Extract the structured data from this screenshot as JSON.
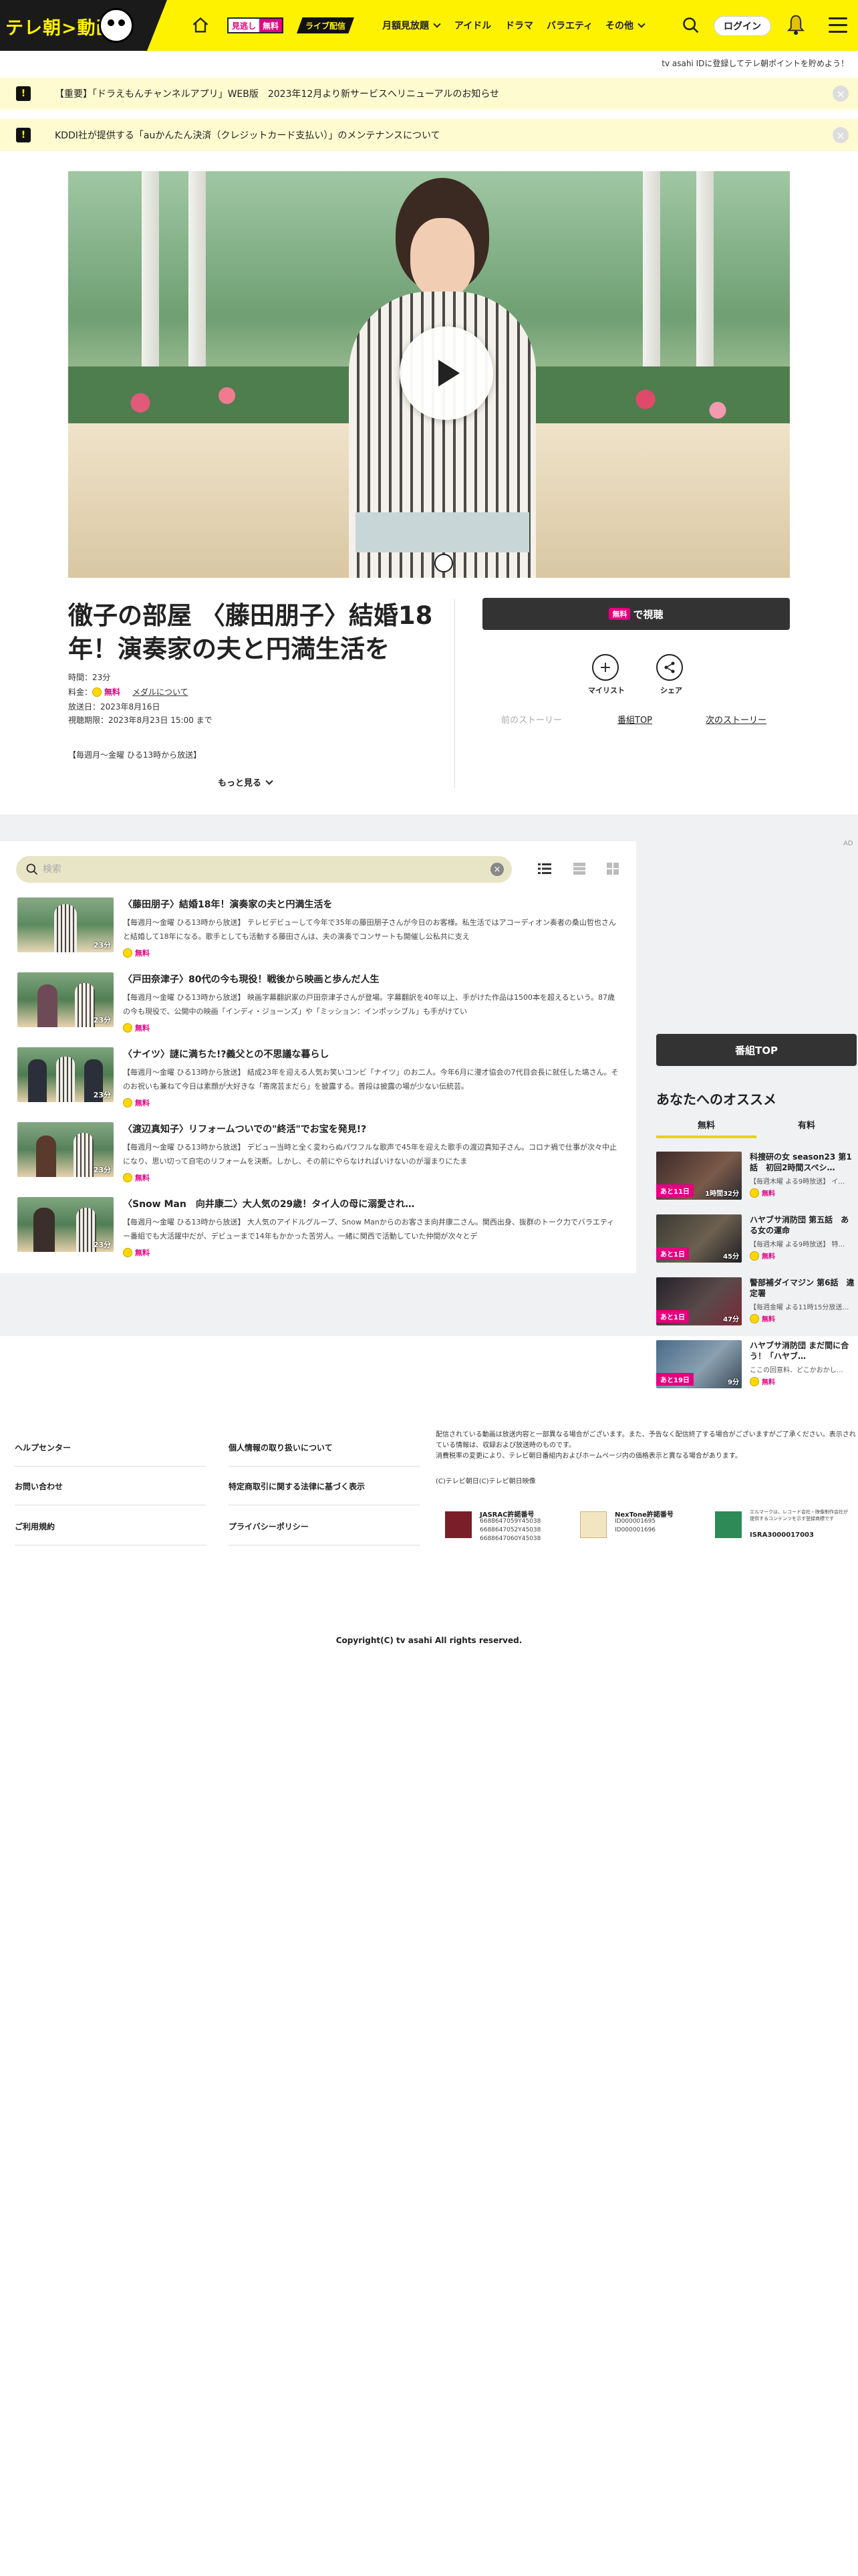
{
  "header": {
    "logo_text": "テレ朝",
    "logo_text2": "動画",
    "free_badge_a": "見逃し",
    "free_badge_b": "無料",
    "live_badge": "ライブ配信",
    "nav": [
      {
        "label": "月額見放題",
        "has_menu": true
      },
      {
        "label": "アイドル",
        "has_menu": false
      },
      {
        "label": "ドラマ",
        "has_menu": false
      },
      {
        "label": "バラエティ",
        "has_menu": false
      },
      {
        "label": "その他",
        "has_menu": true
      }
    ],
    "login_label": "ログイン"
  },
  "register_note": "tv asahi IDに登録してテレ朝ポイントを貯めよう！",
  "notices": [
    {
      "text": "【重要】「ドラえもんチャンネルアプリ」WEB版　2023年12月より新サービスへリニューアルのお知らせ"
    },
    {
      "text": "KDDI社が提供する「auかんたん決済（クレジットカード支払い）」のメンテナンスについて"
    }
  ],
  "episode": {
    "title": "徹子の部屋 〈藤田朋子〉結婚18年！演奏家の夫と円満生活を",
    "duration": "時間：23分",
    "price_label": "料金：",
    "price_value": "無料",
    "price_link": "メダルについて",
    "air_date": "放送日：2023年8月16日",
    "deadline": "視聴期限：2023年8月23日 15:00 まで",
    "broadcast": "【毎週月～金曜 ひる13時から放送】",
    "more_label": "もっと見る",
    "watch_free_badge": "無料",
    "watch_label": "で視聴",
    "mylist_label": "マイリスト",
    "share_label": "シェア",
    "prev_story": "前のストーリー",
    "program_top": "番組TOP",
    "next_story": "次のストーリー"
  },
  "list": {
    "search_placeholder": "検索",
    "items": [
      {
        "title": "〈藤田朋子〉結婚18年！演奏家の夫と円満生活を",
        "desc": "【毎週月～金曜 ひる13時から放送】 テレビデビューして今年で35年の藤田朋子さんが今日のお客様。私生活ではアコーディオン奏者の桑山哲也さんと結婚して18年になる。歌手としても活動する藤田さんは、夫の演奏でコンサートも開催し公私共に支え",
        "duration": "23分",
        "free": "無料"
      },
      {
        "title": "〈戸田奈津子〉80代の今も現役！戦後から映画と歩んだ人生",
        "desc": "【毎週月～金曜 ひる13時から放送】 映画字幕翻訳家の戸田奈津子さんが登場。字幕翻訳を40年以上、手がけた作品は1500本を超えるという。87歳の今も現役で、公開中の映画「インディ・ジョーンズ」や「ミッション：インポッシブル」も手がけてい",
        "duration": "23分",
        "free": "無料"
      },
      {
        "title": "〈ナイツ〉謎に満ちた!?義父との不思議な暮らし",
        "desc": "【毎週月～金曜 ひる13時から放送】 結成23年を迎える人気お笑いコンビ「ナイツ」のお二人。今年6月に漫才協会の7代目会長に就任した塙さん。そのお祝いも兼ねて今日は素顔が大好きな「寄席芸まだら」を披露する。普段は披露の場が少ない伝統芸。",
        "duration": "23分",
        "free": "無料"
      },
      {
        "title": "〈渡辺真知子〉リフォームついでの\"終活\"でお宝を発見!?",
        "desc": "【毎週月～金曜 ひる13時から放送】 デビュー当時と全く変わらぬパワフルな歌声で45年を迎えた歌手の渡辺真知子さん。コロナ禍で仕事が次々中止になり、思い切って自宅のリフォームを決断。しかし、その前にやらなければいけないのが溜まりにたま",
        "duration": "23分",
        "free": "無料"
      },
      {
        "title": "〈Snow Man　向井康二〉大人気の29歳！タイ人の母に溺愛され…",
        "desc": "【毎週月～金曜 ひる13時から放送】 大人気のアイドルグループ、Snow Manからのお客さま向井康二さん。関西出身、抜群のトーク力でバラエティー番組でも大活躍中だが、デビューまで14年もかかった苦労人。一緒に関西で活動していた仲間が次々とデ",
        "duration": "23分",
        "free": "無料"
      }
    ]
  },
  "sidebar": {
    "ad_label": "AD",
    "program_top": "番組TOP",
    "rec_title": "あなたへのオススメ",
    "tab_free": "無料",
    "tab_paid": "有料",
    "items": [
      {
        "left": "あと11日",
        "len": "1時間32分",
        "title": "科捜研の女 season23 第1話　初回2時間スペシ…",
        "desc": "【毎週木曜 よる9時放送】 イ…",
        "free": "無料"
      },
      {
        "left": "あと1日",
        "len": "45分",
        "title": "ハヤブサ消防団 第五話　ある女の運命",
        "desc": "【毎週木曜 よる9時放送】 特…",
        "free": "無料"
      },
      {
        "left": "あと1日",
        "len": "47分",
        "title": "警部補ダイマジン 第6話　違定署",
        "desc": "【毎週金曜 よる11時15分放送…",
        "free": "無料"
      },
      {
        "left": "あと19日",
        "len": "9分",
        "title": "ハヤブサ消防団 まだ間に合う！「ハヤブ…",
        "desc": "ここの回意料、どこかおかし…",
        "free": "無料"
      }
    ]
  },
  "footer": {
    "links": [
      "ヘルプセンター",
      "お問い合わせ",
      "ご利用規約",
      "個人情報の取り扱いについて",
      "特定商取引に関する法律に基づく表示",
      "プライバシーポリシー"
    ],
    "note_lines": [
      "配信されている動画は放送内容と一部異なる場合がございます。また、予告なく配信終了する場合がございますがご了承ください。表示されている情報は、収録および放送時のものです。",
      "消費税率の変更により、テレビ朝日番組内およびホームページ内の価格表示と異なる場合があります。"
    ],
    "copyright2": "(C)テレビ朝日(C)テレビ朝日映像",
    "licenses": [
      {
        "title": "JASRAC許諾番号",
        "nums": [
          "6688647059Y45038",
          "6688647052Y45038",
          "6688647060Y45038"
        ]
      },
      {
        "title": "NexTone許諾番号",
        "nums": [
          "ID000001695",
          "ID000001696"
        ]
      },
      {
        "title": "ISRA3000017003",
        "nums": [
          "エルマークは、レコード会社・映像制作会社が提供するコンテンツを示す登録商標です"
        ]
      }
    ],
    "copyright": "Copyright(C) tv asahi All rights reserved."
  },
  "colors": {
    "brand_yellow": "#fff200",
    "free_pink": "#e4007f",
    "button_dark": "#333333",
    "notice_bg": "#fffbd0"
  }
}
